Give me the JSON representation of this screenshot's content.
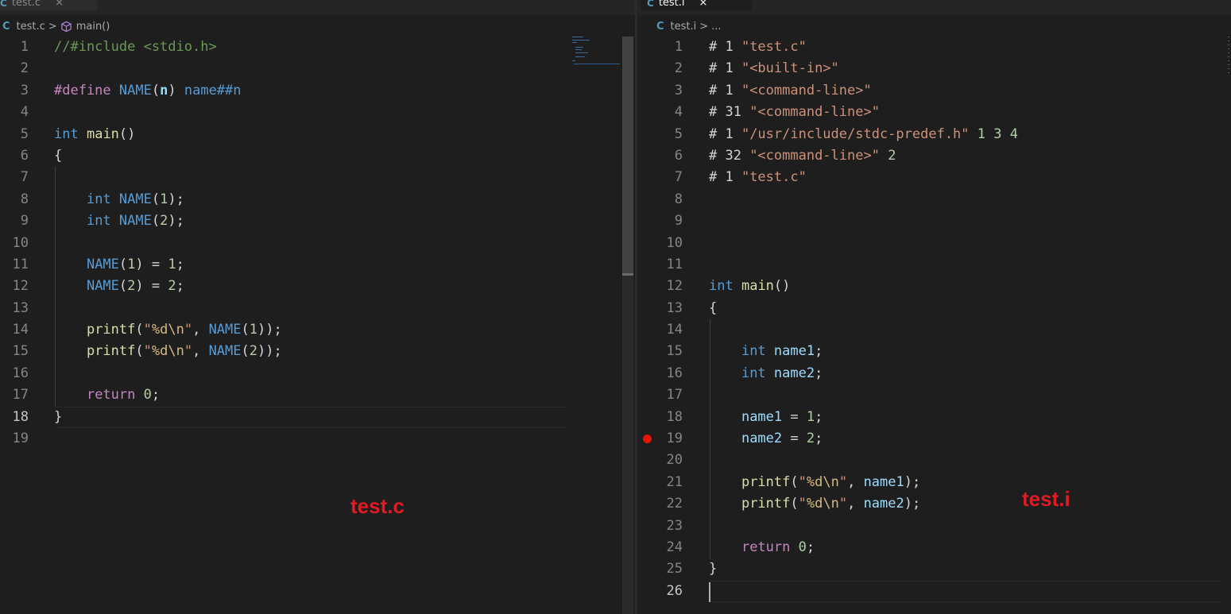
{
  "left_pane": {
    "tab": {
      "icon": "C",
      "label": "test.c",
      "close": "×"
    },
    "breadcrumb": {
      "icon": "C",
      "file": "test.c",
      "separator": ">",
      "symbol_icon": "cube-icon",
      "symbol": "main()"
    },
    "lines": [
      {
        "n": "1",
        "tokens": [
          [
            "cmt",
            "//#include <stdio.h>"
          ]
        ]
      },
      {
        "n": "2",
        "tokens": []
      },
      {
        "n": "3",
        "tokens": [
          [
            "ctl",
            "#define"
          ],
          [
            "pun",
            " "
          ],
          [
            "mac",
            "NAME"
          ],
          [
            "pun",
            "("
          ],
          [
            "param",
            "n"
          ],
          [
            "pun",
            ")"
          ],
          [
            "pun",
            " "
          ],
          [
            "mac",
            "name##n"
          ]
        ]
      },
      {
        "n": "4",
        "tokens": []
      },
      {
        "n": "5",
        "tokens": [
          [
            "kw",
            "int"
          ],
          [
            "pun",
            " "
          ],
          [
            "fn",
            "main"
          ],
          [
            "pun",
            "()"
          ]
        ]
      },
      {
        "n": "6",
        "tokens": [
          [
            "pun",
            "{"
          ]
        ]
      },
      {
        "n": "7",
        "tokens": []
      },
      {
        "n": "8",
        "tokens": [
          [
            "pun",
            "    "
          ],
          [
            "kw",
            "int"
          ],
          [
            "pun",
            " "
          ],
          [
            "mac",
            "NAME"
          ],
          [
            "pun",
            "("
          ],
          [
            "num",
            "1"
          ],
          [
            "pun",
            ");"
          ]
        ]
      },
      {
        "n": "9",
        "tokens": [
          [
            "pun",
            "    "
          ],
          [
            "kw",
            "int"
          ],
          [
            "pun",
            " "
          ],
          [
            "mac",
            "NAME"
          ],
          [
            "pun",
            "("
          ],
          [
            "num",
            "2"
          ],
          [
            "pun",
            ");"
          ]
        ]
      },
      {
        "n": "10",
        "tokens": []
      },
      {
        "n": "11",
        "tokens": [
          [
            "pun",
            "    "
          ],
          [
            "mac",
            "NAME"
          ],
          [
            "pun",
            "("
          ],
          [
            "num",
            "1"
          ],
          [
            "pun",
            ") = "
          ],
          [
            "num",
            "1"
          ],
          [
            "pun",
            ";"
          ]
        ]
      },
      {
        "n": "12",
        "tokens": [
          [
            "pun",
            "    "
          ],
          [
            "mac",
            "NAME"
          ],
          [
            "pun",
            "("
          ],
          [
            "num",
            "2"
          ],
          [
            "pun",
            ") = "
          ],
          [
            "num",
            "2"
          ],
          [
            "pun",
            ";"
          ]
        ]
      },
      {
        "n": "13",
        "tokens": []
      },
      {
        "n": "14",
        "tokens": [
          [
            "pun",
            "    "
          ],
          [
            "fn",
            "printf"
          ],
          [
            "pun",
            "("
          ],
          [
            "str",
            "\""
          ],
          [
            "esc",
            "%d\\n"
          ],
          [
            "str",
            "\""
          ],
          [
            "pun",
            ", "
          ],
          [
            "mac",
            "NAME"
          ],
          [
            "pun",
            "("
          ],
          [
            "num",
            "1"
          ],
          [
            "pun",
            "));"
          ]
        ]
      },
      {
        "n": "15",
        "tokens": [
          [
            "pun",
            "    "
          ],
          [
            "fn",
            "printf"
          ],
          [
            "pun",
            "("
          ],
          [
            "str",
            "\""
          ],
          [
            "esc",
            "%d\\n"
          ],
          [
            "str",
            "\""
          ],
          [
            "pun",
            ", "
          ],
          [
            "mac",
            "NAME"
          ],
          [
            "pun",
            "("
          ],
          [
            "num",
            "2"
          ],
          [
            "pun",
            "));"
          ]
        ]
      },
      {
        "n": "16",
        "tokens": []
      },
      {
        "n": "17",
        "tokens": [
          [
            "pun",
            "    "
          ],
          [
            "ctl",
            "return"
          ],
          [
            "pun",
            " "
          ],
          [
            "num",
            "0"
          ],
          [
            "pun",
            ";"
          ]
        ]
      },
      {
        "n": "18",
        "tokens": [
          [
            "pun",
            "}"
          ]
        ],
        "active": true
      },
      {
        "n": "19",
        "tokens": []
      }
    ],
    "overlay_label": "test.c"
  },
  "right_pane": {
    "tab": {
      "icon": "C",
      "label": "test.i",
      "close": "×"
    },
    "breadcrumb": {
      "icon": "C",
      "file": "test.i",
      "separator": ">",
      "rest": "..."
    },
    "lines": [
      {
        "n": "1",
        "tokens": [
          [
            "pun",
            "# 1 "
          ],
          [
            "str",
            "\"test.c\""
          ]
        ]
      },
      {
        "n": "2",
        "tokens": [
          [
            "pun",
            "# 1 "
          ],
          [
            "str",
            "\"<built-in>\""
          ]
        ]
      },
      {
        "n": "3",
        "tokens": [
          [
            "pun",
            "# 1 "
          ],
          [
            "str",
            "\"<command-line>\""
          ]
        ]
      },
      {
        "n": "4",
        "tokens": [
          [
            "pun",
            "# 31 "
          ],
          [
            "str",
            "\"<command-line>\""
          ]
        ]
      },
      {
        "n": "5",
        "tokens": [
          [
            "pun",
            "# 1 "
          ],
          [
            "str",
            "\"/usr/include/stdc-predef.h\""
          ],
          [
            "pun",
            " "
          ],
          [
            "num",
            "1 3 4"
          ]
        ]
      },
      {
        "n": "6",
        "tokens": [
          [
            "pun",
            "# 32 "
          ],
          [
            "str",
            "\"<command-line>\""
          ],
          [
            "pun",
            " "
          ],
          [
            "num",
            "2"
          ]
        ]
      },
      {
        "n": "7",
        "tokens": [
          [
            "pun",
            "# 1 "
          ],
          [
            "str",
            "\"test.c\""
          ]
        ]
      },
      {
        "n": "8",
        "tokens": []
      },
      {
        "n": "9",
        "tokens": []
      },
      {
        "n": "10",
        "tokens": []
      },
      {
        "n": "11",
        "tokens": []
      },
      {
        "n": "12",
        "tokens": [
          [
            "kw",
            "int"
          ],
          [
            "pun",
            " "
          ],
          [
            "fn",
            "main"
          ],
          [
            "pun",
            "()"
          ]
        ]
      },
      {
        "n": "13",
        "tokens": [
          [
            "pun",
            "{"
          ]
        ]
      },
      {
        "n": "14",
        "tokens": []
      },
      {
        "n": "15",
        "tokens": [
          [
            "pun",
            "    "
          ],
          [
            "kw",
            "int"
          ],
          [
            "pun",
            " "
          ],
          [
            "var",
            "name1"
          ],
          [
            "pun",
            ";"
          ]
        ]
      },
      {
        "n": "16",
        "tokens": [
          [
            "pun",
            "    "
          ],
          [
            "kw",
            "int"
          ],
          [
            "pun",
            " "
          ],
          [
            "var",
            "name2"
          ],
          [
            "pun",
            ";"
          ]
        ]
      },
      {
        "n": "17",
        "tokens": []
      },
      {
        "n": "18",
        "tokens": [
          [
            "pun",
            "    "
          ],
          [
            "var",
            "name1"
          ],
          [
            "pun",
            " = "
          ],
          [
            "num",
            "1"
          ],
          [
            "pun",
            ";"
          ]
        ]
      },
      {
        "n": "19",
        "tokens": [
          [
            "pun",
            "    "
          ],
          [
            "var",
            "name2"
          ],
          [
            "pun",
            " = "
          ],
          [
            "num",
            "2"
          ],
          [
            "pun",
            ";"
          ]
        ],
        "breakpoint": true
      },
      {
        "n": "20",
        "tokens": []
      },
      {
        "n": "21",
        "tokens": [
          [
            "pun",
            "    "
          ],
          [
            "fn",
            "printf"
          ],
          [
            "pun",
            "("
          ],
          [
            "str",
            "\""
          ],
          [
            "esc",
            "%d\\n"
          ],
          [
            "str",
            "\""
          ],
          [
            "pun",
            ", "
          ],
          [
            "var",
            "name1"
          ],
          [
            "pun",
            ");"
          ]
        ]
      },
      {
        "n": "22",
        "tokens": [
          [
            "pun",
            "    "
          ],
          [
            "fn",
            "printf"
          ],
          [
            "pun",
            "("
          ],
          [
            "str",
            "\""
          ],
          [
            "esc",
            "%d\\n"
          ],
          [
            "str",
            "\""
          ],
          [
            "pun",
            ", "
          ],
          [
            "var",
            "name2"
          ],
          [
            "pun",
            ");"
          ]
        ]
      },
      {
        "n": "23",
        "tokens": []
      },
      {
        "n": "24",
        "tokens": [
          [
            "pun",
            "    "
          ],
          [
            "ctl",
            "return"
          ],
          [
            "pun",
            " "
          ],
          [
            "num",
            "0"
          ],
          [
            "pun",
            ";"
          ]
        ]
      },
      {
        "n": "25",
        "tokens": [
          [
            "pun",
            "}"
          ]
        ]
      },
      {
        "n": "26",
        "tokens": [],
        "active": true
      }
    ],
    "overlay_label": "test.i"
  },
  "colors": {
    "background": "#1e1e1e",
    "keyword": "#569cd6",
    "control": "#c586c0",
    "function": "#dcdcaa",
    "variable": "#9cdcfe",
    "number": "#b5cea8",
    "string": "#ce9178",
    "comment": "#6a9955",
    "breakpoint": "#e51400",
    "overlay_label": "#e01b24"
  }
}
